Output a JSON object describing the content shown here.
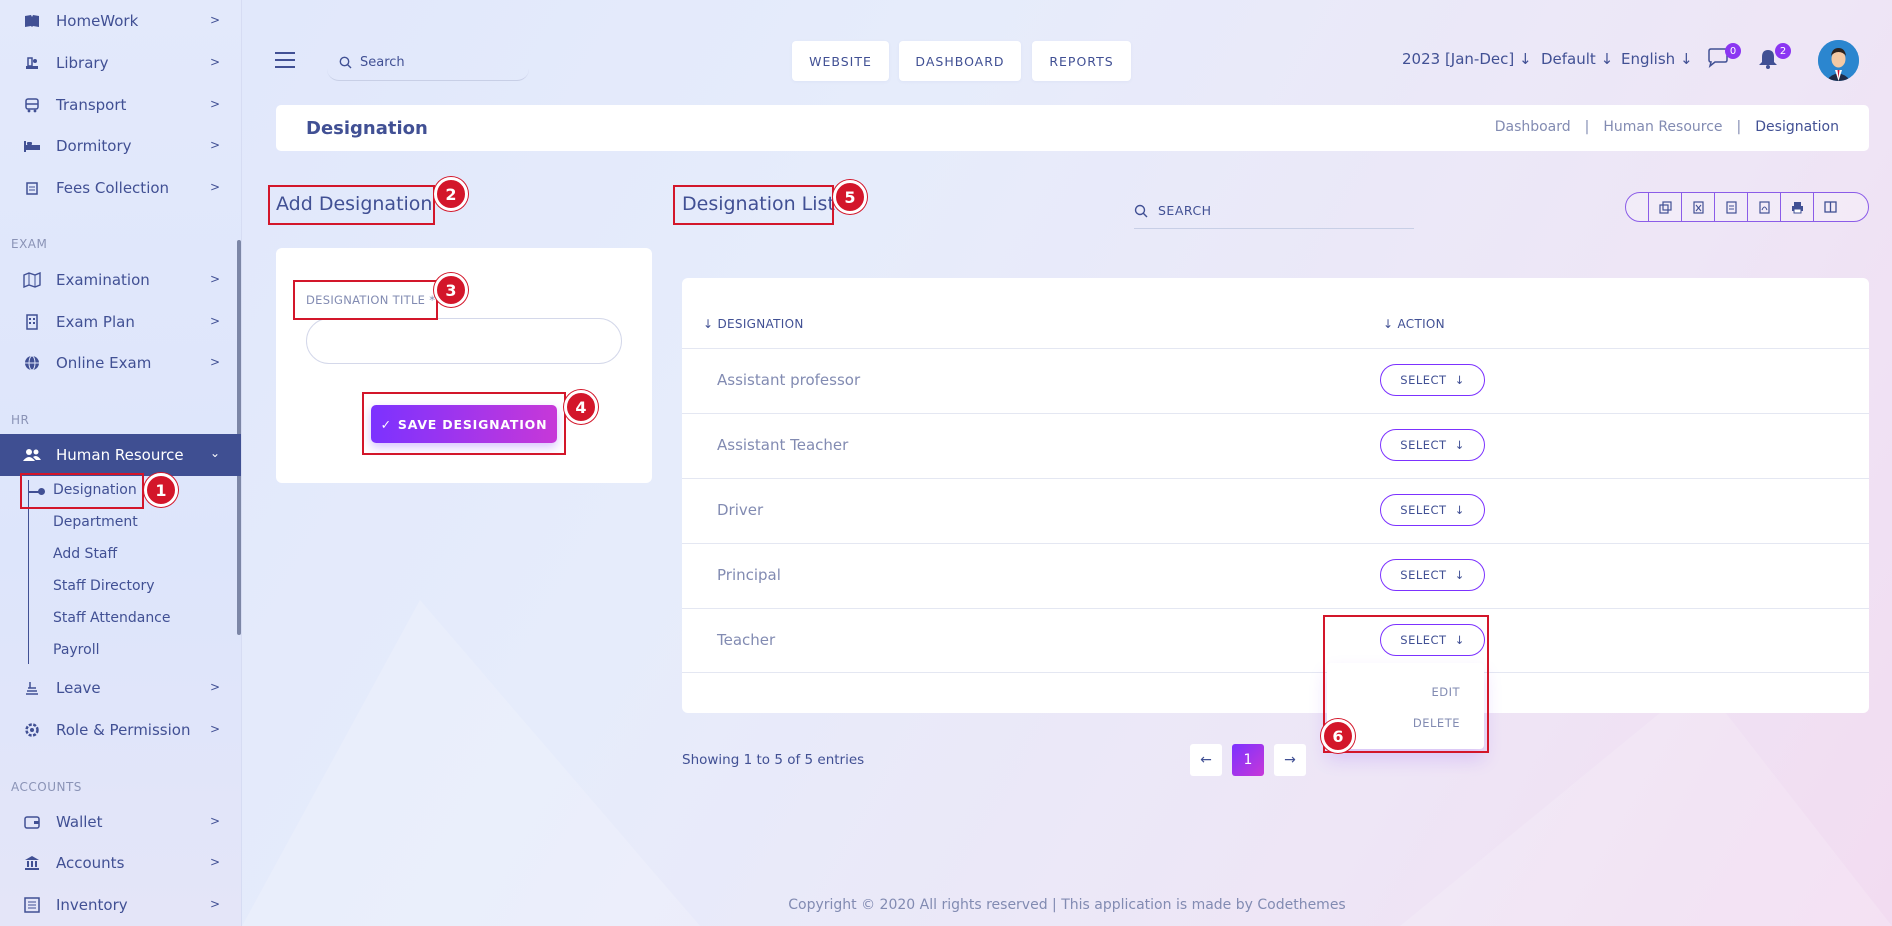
{
  "sidebar": {
    "top_items": [
      {
        "label": "HomeWork",
        "icon": "book-icon"
      },
      {
        "label": "Library",
        "icon": "library-icon"
      },
      {
        "label": "Transport",
        "icon": "bus-icon"
      },
      {
        "label": "Dormitory",
        "icon": "bed-icon"
      },
      {
        "label": "Fees Collection",
        "icon": "fees-icon"
      }
    ],
    "sections": {
      "exam": "EXAM",
      "hr": "HR",
      "accounts": "ACCOUNTS"
    },
    "exam_items": [
      {
        "label": "Examination",
        "icon": "map-icon"
      },
      {
        "label": "Exam Plan",
        "icon": "building-icon"
      },
      {
        "label": "Online Exam",
        "icon": "globe-icon"
      }
    ],
    "hr_item": {
      "label": "Human Resource",
      "icon": "users-icon"
    },
    "hr_sub": [
      "Designation",
      "Department",
      "Add Staff",
      "Staff Directory",
      "Staff Attendance",
      "Payroll"
    ],
    "after_hr": [
      {
        "label": "Leave",
        "icon": "leave-icon"
      },
      {
        "label": "Role & Permission",
        "icon": "gear-icon"
      }
    ],
    "accounts_items": [
      {
        "label": "Wallet",
        "icon": "wallet-icon"
      },
      {
        "label": "Accounts",
        "icon": "bank-icon"
      },
      {
        "label": "Inventory",
        "icon": "inventory-icon"
      }
    ]
  },
  "topbar": {
    "search_placeholder": "Search",
    "buttons": [
      "WEBSITE",
      "DASHBOARD",
      "REPORTS"
    ],
    "session": "2023 [Jan-Dec]",
    "theme": "Default",
    "language": "English",
    "messages_count": "0",
    "notifications_count": "2"
  },
  "breadcrumb": {
    "title": "Designation",
    "items": [
      "Dashboard",
      "Human Resource",
      "Designation"
    ]
  },
  "add_form": {
    "heading": "Add Designation",
    "field_label": "DESIGNATION TITLE *",
    "field_value": "",
    "save_label": "SAVE DESIGNATION"
  },
  "list": {
    "heading": "Designation List",
    "search_placeholder": "SEARCH",
    "export_icons": [
      "copy-icon",
      "excel-icon",
      "csv-icon",
      "pdf-icon",
      "print-icon",
      "columns-icon"
    ],
    "columns": [
      "DESIGNATION",
      "ACTION"
    ],
    "rows": [
      "Assistant professor",
      "Assistant Teacher",
      "Driver",
      "Principal",
      "Teacher"
    ],
    "select_label": "SELECT",
    "dropdown": [
      "EDIT",
      "DELETE"
    ],
    "showing": "Showing 1 to 5 of 5 entries",
    "page": "1"
  },
  "markers": [
    "1",
    "2",
    "3",
    "4",
    "5",
    "6"
  ],
  "footer": "Copyright © 2020 All rights reserved | This application is made by Codethemes",
  "colors": {
    "accent": "#7c32ff",
    "primary": "#415094",
    "marker": "#d3162a"
  }
}
